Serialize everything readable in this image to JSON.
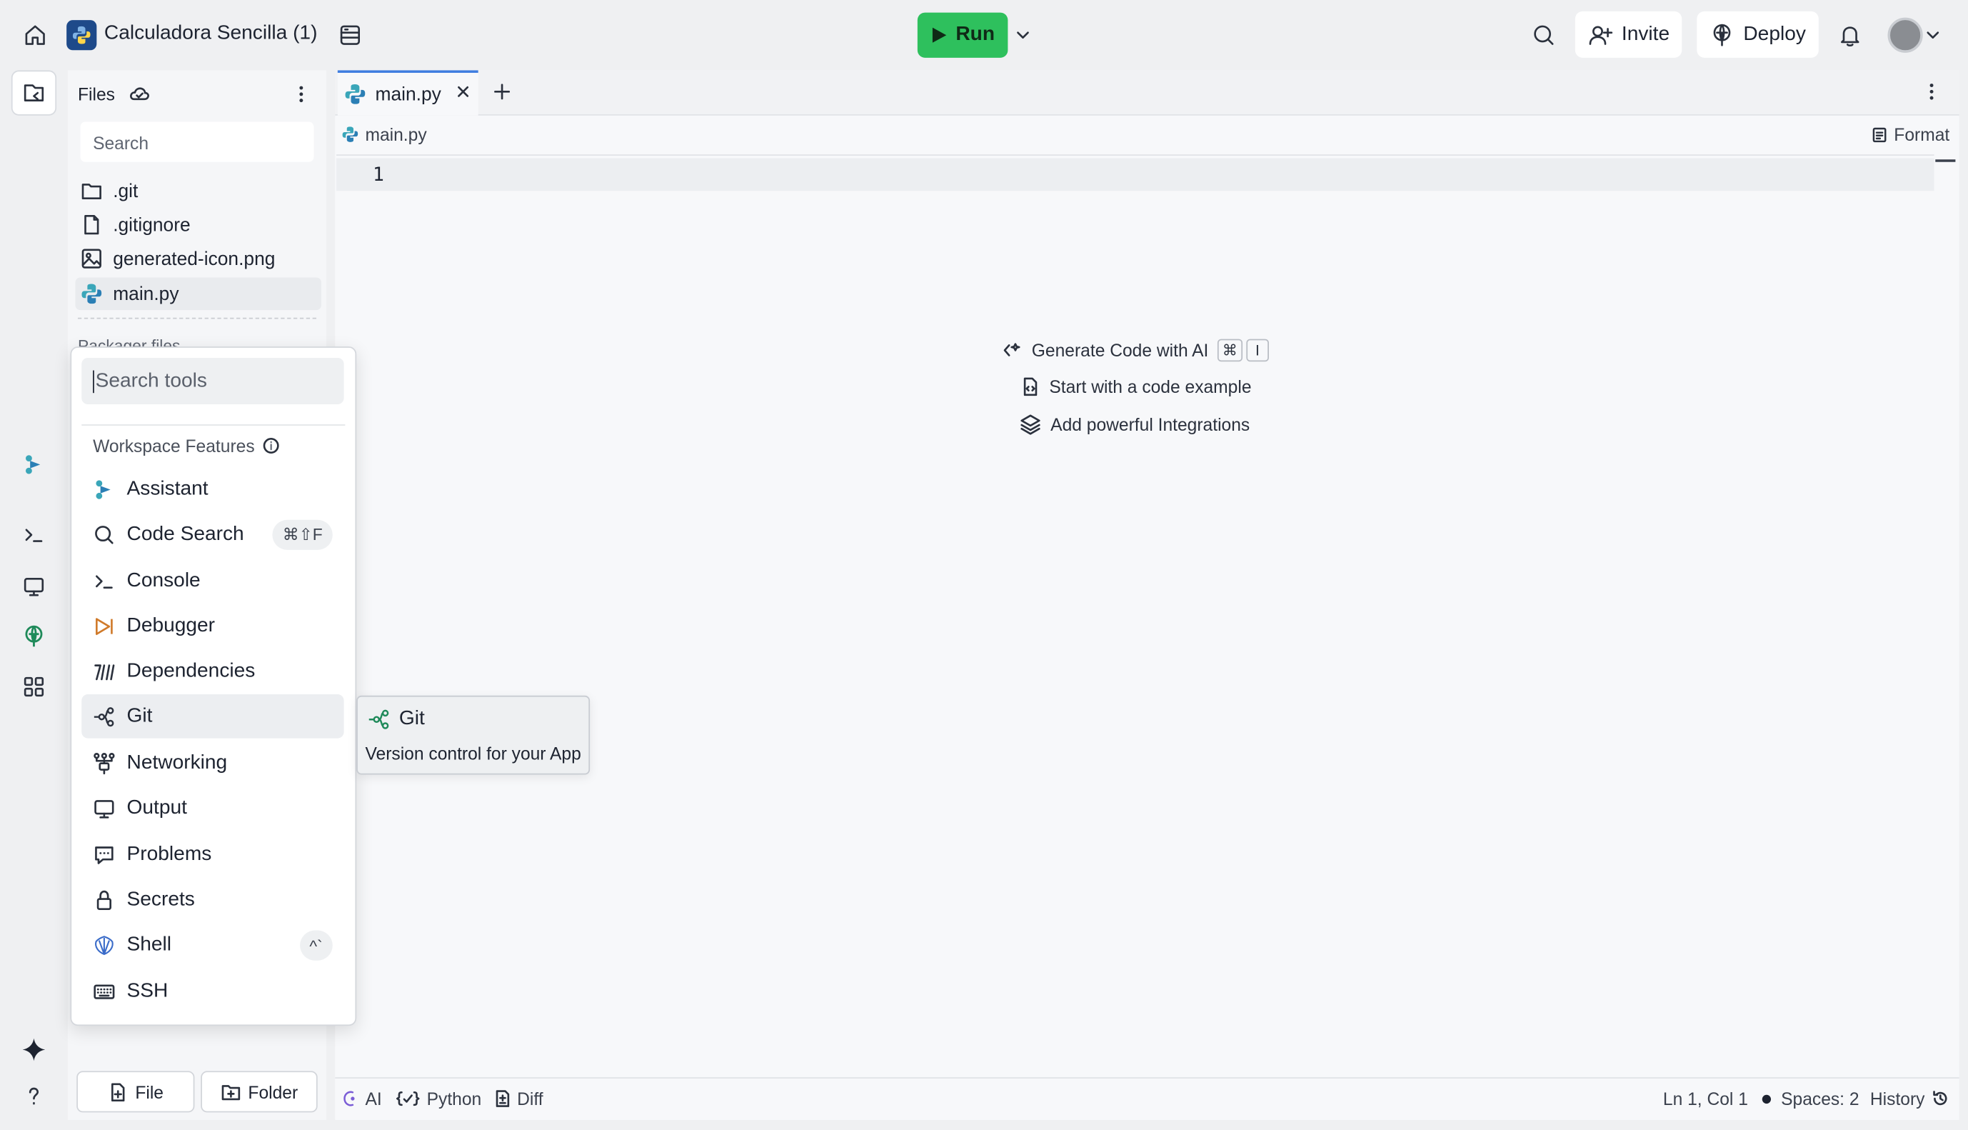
{
  "app": {
    "title": "Calculadora Sencilla (1)"
  },
  "topbar": {
    "run_label": "Run",
    "invite_label": "Invite",
    "deploy_label": "Deploy"
  },
  "files": {
    "title": "Files",
    "search_placeholder": "Search",
    "items": [
      {
        "name": ".git",
        "icon": "folder-icon"
      },
      {
        "name": ".gitignore",
        "icon": "file-icon"
      },
      {
        "name": "generated-icon.png",
        "icon": "image-icon"
      },
      {
        "name": "main.py",
        "icon": "python-icon"
      }
    ],
    "packager_label": "Packager files",
    "new_file_label": "File",
    "new_folder_label": "Folder"
  },
  "editor": {
    "tab_label": "main.py",
    "breadcrumb": "main.py",
    "format_label": "Format",
    "line_number": "1",
    "hints": {
      "generate": "Generate Code with AI",
      "generate_keys": [
        "⌘",
        "I"
      ],
      "example": "Start with a code example",
      "integrations": "Add powerful Integrations"
    }
  },
  "statusbar": {
    "ai": "AI",
    "language": "Python",
    "diff": "Diff",
    "position": "Ln 1, Col 1",
    "spaces": "Spaces: 2",
    "history": "History"
  },
  "tools_menu": {
    "search_placeholder": "Search tools",
    "section_title": "Workspace Features",
    "items": [
      {
        "label": "Assistant",
        "icon": "assistant-icon"
      },
      {
        "label": "Code Search",
        "icon": "search-icon",
        "shortcut": "⌘⇧F"
      },
      {
        "label": "Console",
        "icon": "console-icon"
      },
      {
        "label": "Debugger",
        "icon": "debugger-icon"
      },
      {
        "label": "Dependencies",
        "icon": "dependencies-icon"
      },
      {
        "label": "Git",
        "icon": "git-icon",
        "highlighted": true
      },
      {
        "label": "Networking",
        "icon": "networking-icon"
      },
      {
        "label": "Output",
        "icon": "monitor-icon"
      },
      {
        "label": "Problems",
        "icon": "problems-icon"
      },
      {
        "label": "Secrets",
        "icon": "lock-icon"
      },
      {
        "label": "Shell",
        "icon": "shell-icon",
        "shortcut": "^`"
      },
      {
        "label": "SSH",
        "icon": "keyboard-icon"
      }
    ]
  },
  "tooltip": {
    "title": "Git",
    "description": "Version control for your App"
  },
  "colors": {
    "run_green": "#2ec05d",
    "tab_accent": "#3f7de0",
    "python_blue": "#3670a0"
  }
}
